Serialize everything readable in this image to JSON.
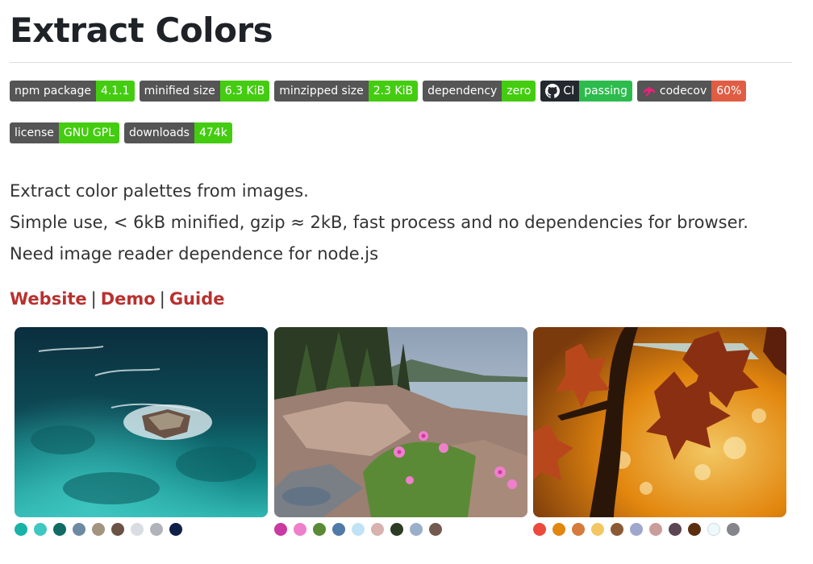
{
  "title": "Extract Colors",
  "badges": [
    {
      "left": "npm package",
      "right": "4.1.1",
      "color": "#4c1"
    },
    {
      "left": "minified size",
      "right": "6.3 KiB",
      "color": "#4c1"
    },
    {
      "left": "minzipped size",
      "right": "2.3 KiB",
      "color": "#4c1"
    },
    {
      "left": "dependency",
      "right": "zero",
      "color": "#4c1"
    },
    {
      "left": "CI",
      "right": "passing",
      "color": "#2dbb4e",
      "icon": "github-icon"
    },
    {
      "left": "codecov",
      "right": "60%",
      "color": "#e05d44",
      "icon": "codecov-icon"
    },
    {
      "left": "license",
      "right": "GNU GPL",
      "color": "#4c1"
    },
    {
      "left": "downloads",
      "right": "474k",
      "color": "#4c1"
    }
  ],
  "description": [
    "Extract color palettes from images.",
    "Simple use, < 6kB minified, gzip ≈ 2kB, fast process and no dependencies for browser.",
    "Need image reader dependence for node.js"
  ],
  "links": {
    "website": "Website",
    "demo": "Demo",
    "guide": "Guide",
    "separator": "|"
  },
  "gallery": [
    {
      "name": "ocean-rock-image",
      "swatches": [
        "#16b3a6",
        "#3fc7c2",
        "#0f6b63",
        "#6d8aa3",
        "#a39480",
        "#6a5244",
        "#d9dde2",
        "#b0b4ba",
        "#102048"
      ]
    },
    {
      "name": "coast-flowers-image",
      "swatches": [
        "#c93aa2",
        "#ef7fcb",
        "#5b8a36",
        "#507aa8",
        "#bfe3f4",
        "#d7b2ae",
        "#2c3b24",
        "#9ab0c9",
        "#735a4f"
      ]
    },
    {
      "name": "autumn-leaves-image",
      "swatches": [
        "#ec4a3e",
        "#e2860e",
        "#d67b3b",
        "#f2c763",
        "#8b5a34",
        "#9ea7ce",
        "#c99d9b",
        "#5b4654",
        "#5a2e0f",
        "#eef9fb",
        "#84868c"
      ]
    }
  ],
  "colors": {
    "link": "#b8312f",
    "badge_left": "#555555",
    "badge_ci_left": "#24292f"
  }
}
